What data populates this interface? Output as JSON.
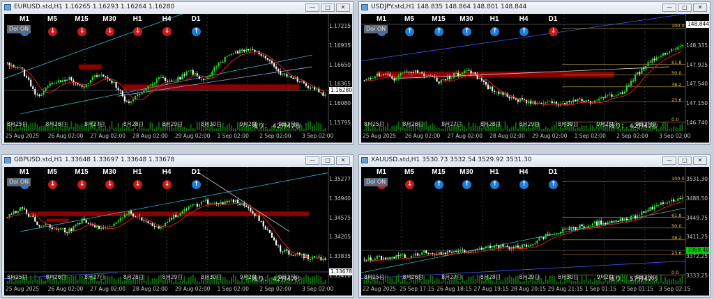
{
  "windows": [
    {
      "key": "eurusd",
      "title": "EURUSD.std,H1  1.16265 1.16293 1.16264 1.16280",
      "y_ticks": [
        "1.17215",
        "1.16935",
        "1.16650",
        "1.16365",
        "1.16080",
        "1.15795"
      ],
      "price_box": "1.16280",
      "price_box_color": "#ffffff",
      "remaining": "残り： 42分47秒",
      "x_labels": [
        "25 Aug 2025",
        "26 Aug 02:00",
        "27 Aug 02:00",
        "28 Aug 02:00",
        "29 Aug 02:00",
        "1 Sep 02:00",
        "2 Sep 02:00",
        "3 Sep 02:00"
      ],
      "x_top": [
        "8月25日",
        "8月26日",
        "8月27日",
        "8月28日",
        "8月29日",
        "8月30日",
        "9月2日",
        "9月3日"
      ],
      "timeframes": [
        {
          "label": "M1",
          "dir": "up"
        },
        {
          "label": "M5",
          "dir": "dn"
        },
        {
          "label": "M15",
          "dir": "dn"
        },
        {
          "label": "M30",
          "dir": "dn"
        },
        {
          "label": "H1",
          "dir": "dn"
        },
        {
          "label": "H4",
          "dir": "dn"
        },
        {
          "label": "D1",
          "dir": "up"
        }
      ],
      "fib": []
    },
    {
      "key": "usdjpy",
      "title": "USDJPY.std,H1  148.835 148.864 148.801 148.844",
      "y_ticks": [
        "148.844",
        "148.335",
        "147.925",
        "147.540",
        "147.150",
        "146.740"
      ],
      "price_box": "148.844",
      "price_box_color": "#ffffff",
      "remaining": "残り： 42分47秒",
      "x_labels": [
        "25 Aug 2025",
        "26 Aug 02:00",
        "27 Aug 02:00",
        "28 Aug 02:00",
        "29 Aug 02:00",
        "1 Sep 02:00",
        "2 Sep 02:00",
        "3 Sep 02:00"
      ],
      "x_top": [
        "8月25日",
        "8月26日",
        "8月27日",
        "8月28日",
        "8月29日",
        "8月30日",
        "9月2日",
        "9月3日"
      ],
      "timeframes": [
        {
          "label": "M1",
          "dir": "up"
        },
        {
          "label": "M5",
          "dir": "up"
        },
        {
          "label": "M15",
          "dir": "up"
        },
        {
          "label": "M30",
          "dir": "up"
        },
        {
          "label": "H1",
          "dir": "up"
        },
        {
          "label": "H4",
          "dir": "up"
        },
        {
          "label": "D1",
          "dir": "dn"
        }
      ],
      "fib": [
        "100.0",
        "61.8",
        "50.0",
        "38.2",
        "23.6",
        "0.0"
      ]
    },
    {
      "key": "gbpusd",
      "title": "GBPUSD.std,H1  1.33648 1.33697 1.33648 1.33678",
      "y_ticks": [
        "1.35277",
        "1.34940",
        "1.34575",
        "1.34205",
        "1.33835",
        "1.33470"
      ],
      "price_box": "1.33678",
      "price_box_color": "#ffffff",
      "remaining": "残り： 42分47秒",
      "x_labels": [
        "25 Aug 2025",
        "26 Aug 02:00",
        "27 Aug 02:00",
        "28 Aug 02:00",
        "29 Aug 02:00",
        "1 Sep 02:00",
        "2 Sep 02:00",
        "3 Sep 02:00"
      ],
      "x_top": [
        "8月25日",
        "8月26日",
        "8月27日",
        "8月28日",
        "8月29日",
        "8月30日",
        "9月2日",
        "9月3日"
      ],
      "timeframes": [
        {
          "label": "M1",
          "dir": "up"
        },
        {
          "label": "M5",
          "dir": "dn"
        },
        {
          "label": "M15",
          "dir": "dn"
        },
        {
          "label": "M30",
          "dir": "dn"
        },
        {
          "label": "H1",
          "dir": "dn"
        },
        {
          "label": "H4",
          "dir": "dn"
        },
        {
          "label": "D1",
          "dir": "up"
        }
      ],
      "fib": []
    },
    {
      "key": "xauusd",
      "title": "XAUUSD.std,H1  3530.73 3532.54 3529.92 3531.30",
      "y_ticks": [
        "3531.30",
        "3488.50",
        "3449.75",
        "3411.25",
        "3372.25",
        "3333.25"
      ],
      "price_box": "3369.40",
      "price_box_color": "#00d000",
      "remaining": "残り： 57分47秒",
      "x_labels": [
        "22 Aug 2025",
        "25 Sep 17:15",
        "26 Aug 18:15",
        "27 Aug 19:15",
        "28 Aug 20:15",
        "29 Aug 21:15",
        "1 Sep 01:15",
        "2 Sep 01:15",
        "3 Sep 02:15"
      ],
      "x_top": [
        "8月25日",
        "8月26日",
        "8月27日",
        "8月28日",
        "8月29日",
        "8月30日",
        "9月2日",
        "9月3日"
      ],
      "timeframes": [
        {
          "label": "M1",
          "dir": "dn"
        },
        {
          "label": "M5",
          "dir": "dn"
        },
        {
          "label": "M15",
          "dir": "up"
        },
        {
          "label": "M30",
          "dir": "up"
        },
        {
          "label": "H1",
          "dir": "up"
        },
        {
          "label": "H4",
          "dir": "up"
        },
        {
          "label": "D1",
          "dir": "up"
        }
      ],
      "fib": [
        "100.0",
        "61.8",
        "50.0",
        "38.2",
        "23.6",
        "0.0"
      ]
    }
  ],
  "ui": {
    "dolbtn": "Dol ON",
    "min_label": "—",
    "max_label": "□",
    "close_label": "✕"
  },
  "colors": {
    "bull": "#19e619",
    "bear": "#ffffff",
    "ma_fast": "#e31b1b",
    "resistance": "#8b0000",
    "trend": "#3b82ff"
  }
}
